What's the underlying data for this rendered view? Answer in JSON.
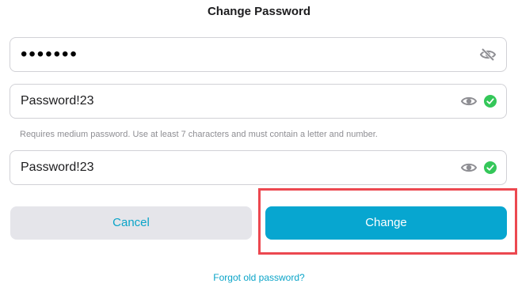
{
  "header": {
    "title": "Change Password"
  },
  "fields": [
    {
      "name": "current-password",
      "masked": true,
      "value": "•••••••",
      "visibility_icon": "eye-slash-icon"
    },
    {
      "name": "new-password",
      "masked": false,
      "value": "Password!23",
      "visibility_icon": "eye-icon",
      "status_icon": "check-circle-icon",
      "status_color": "#34c759"
    },
    {
      "name": "confirm-password",
      "masked": false,
      "value": "Password!23",
      "visibility_icon": "eye-icon",
      "status_icon": "check-circle-icon",
      "status_color": "#34c759"
    }
  ],
  "hint": "Requires medium password. Use at least 7 characters and must contain a letter and number.",
  "buttons": {
    "cancel_label": "Cancel",
    "change_label": "Change"
  },
  "links": {
    "forgot_label": "Forgot old password?"
  },
  "colors": {
    "accent": "#07a6d0",
    "link": "#0aa4c8",
    "success": "#34c759",
    "highlight": "#ec4850",
    "cancel_bg": "#e5e5ea"
  }
}
